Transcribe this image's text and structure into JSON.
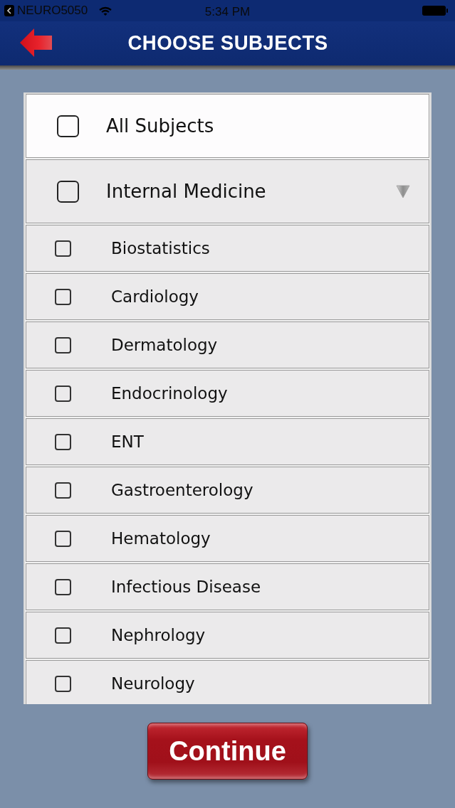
{
  "status_bar": {
    "back_label": "NEURO5050",
    "time": "5:34 PM"
  },
  "nav": {
    "title": "CHOOSE SUBJECTS"
  },
  "all_subjects": {
    "label": "All Subjects",
    "checked": false
  },
  "group": {
    "label": "Internal Medicine",
    "checked": false,
    "expanded": true,
    "children": [
      {
        "label": "Biostatistics",
        "checked": false
      },
      {
        "label": "Cardiology",
        "checked": false
      },
      {
        "label": "Dermatology",
        "checked": false
      },
      {
        "label": "Endocrinology",
        "checked": false
      },
      {
        "label": "ENT",
        "checked": false
      },
      {
        "label": "Gastroenterology",
        "checked": false
      },
      {
        "label": "Hematology",
        "checked": false
      },
      {
        "label": "Infectious Disease",
        "checked": false
      },
      {
        "label": "Nephrology",
        "checked": false
      },
      {
        "label": "Neurology",
        "checked": false
      }
    ]
  },
  "continue_button": {
    "label": "Continue"
  }
}
